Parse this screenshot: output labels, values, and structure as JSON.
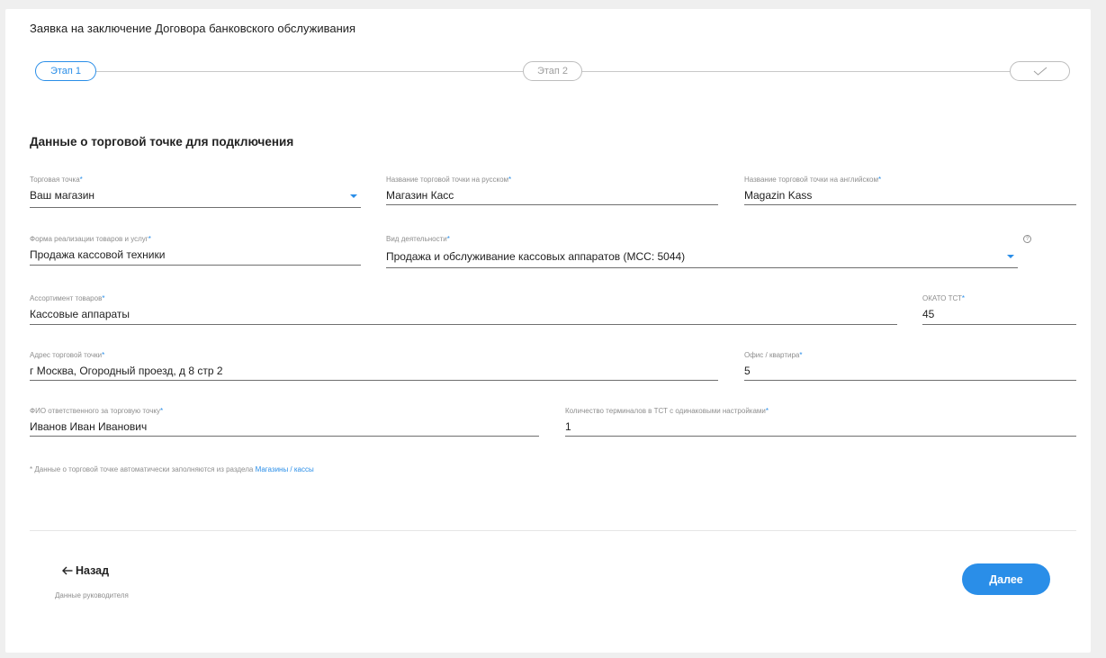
{
  "page": {
    "title": "Заявка на заключение Договора банковского обслуживания"
  },
  "stepper": {
    "steps": [
      "Этап 1",
      "Этап 2"
    ],
    "final_icon": "check-icon",
    "active_color": "#2a8ee8"
  },
  "section": {
    "title": "Данные о торговой точке для подключения"
  },
  "fields": {
    "outlet": {
      "label": "Торговая точка",
      "value": "Ваш магазин"
    },
    "name_ru": {
      "label": "Название торговой точки на русском",
      "value": "Магазин Касс"
    },
    "name_en": {
      "label": "Название торговой точки на английском",
      "value": "Magazin Kass"
    },
    "sales_form": {
      "label": "Форма реализации товаров и услуг",
      "value": "Продажа кассовой техники"
    },
    "activity": {
      "label": "Вид деятельности",
      "value": "Продажа и обслуживание кассовых аппаратов (MCC: 5044)"
    },
    "assortment": {
      "label": "Ассортимент товаров",
      "value": "Кассовые аппараты"
    },
    "okato": {
      "label": "ОКАТО ТСТ",
      "value": "45"
    },
    "address": {
      "label": "Адрес торговой точки",
      "value": "г Москва, Огородный проезд, д 8 стр 2"
    },
    "office": {
      "label": "Офис / квартира",
      "value": "5"
    },
    "responsible": {
      "label": "ФИО ответственного за торговую точку",
      "value": "Иванов Иван Иванович"
    },
    "terminals": {
      "label": "Количество терминалов в ТСТ с одинаковыми настройками",
      "value": "1"
    }
  },
  "required_mark": "*",
  "help_icon_glyph": "?",
  "footnote": {
    "text": "* Данные о торговой точке автоматически заполняются из раздела ",
    "link": "Магазины / кассы"
  },
  "nav": {
    "back_label": "Назад",
    "back_sub": "Данные руководителя",
    "next_label": "Далее"
  }
}
